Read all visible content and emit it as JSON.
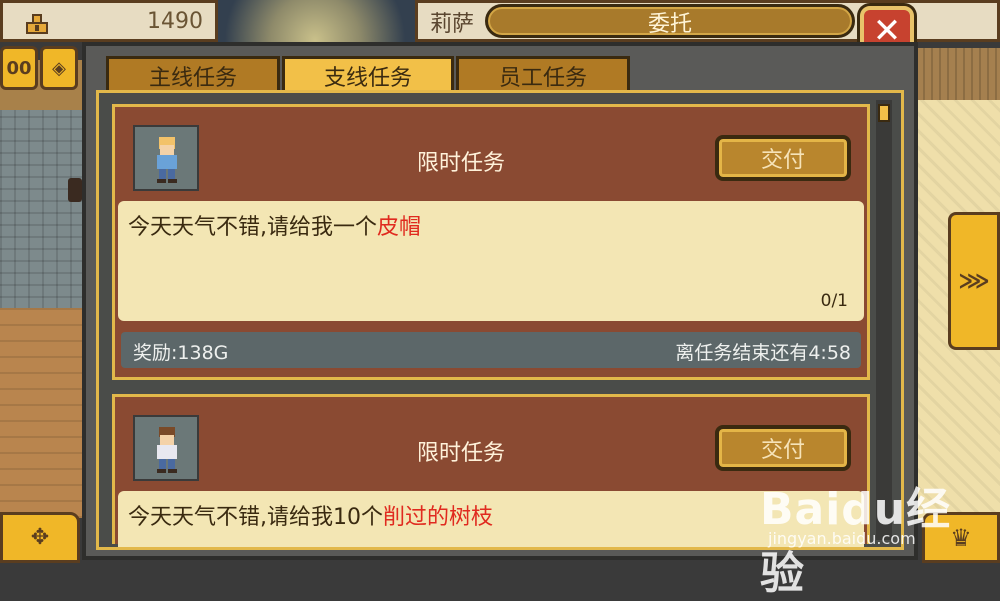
{
  "hud": {
    "coins": "1490",
    "npc_name": "莉萨",
    "window_title": "委托",
    "left_buttons": [
      "00",
      "◈"
    ]
  },
  "tabs": [
    {
      "label": "主线任务",
      "active": false
    },
    {
      "label": "支线任务",
      "active": true
    },
    {
      "label": "员工任务",
      "active": false
    }
  ],
  "quests": [
    {
      "title": "限时任务",
      "deliver_label": "交付",
      "message_prefix": "今天天气不错,请给我一个",
      "message_item": "皮帽",
      "progress": "0/1",
      "reward": "奖励:138G",
      "time_left": "离任务结束还有4:58"
    },
    {
      "title": "限时任务",
      "deliver_label": "交付",
      "message_prefix": "今天天气不错,请给我10个",
      "message_item": "削过的树枝"
    }
  ],
  "nav": {
    "next_glyph": "⋙",
    "bottom_left_glyph": "✥",
    "bottom_right_glyph": "♛"
  },
  "watermark": {
    "logo": "Baidu经验",
    "url": "jingyan.baidu.com"
  },
  "colors": {
    "highlight_item": "#e02a1f",
    "tab_active": "#f2c048",
    "tab_inactive": "#b07a24",
    "card_bg": "#8a4a32"
  }
}
